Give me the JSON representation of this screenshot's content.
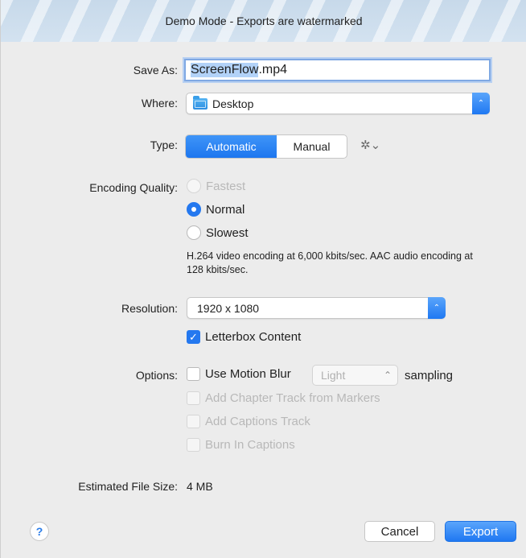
{
  "window": {
    "banner": "Demo Mode - Exports are watermarked"
  },
  "save_as": {
    "label": "Save As:",
    "selected_part": "ScreenFlow",
    "extension": ".mp4"
  },
  "where": {
    "label": "Where:",
    "value": "Desktop",
    "icon": "folder-icon"
  },
  "type": {
    "label": "Type:",
    "options": [
      "Automatic",
      "Manual"
    ],
    "selected": "Automatic"
  },
  "encoding_quality": {
    "label": "Encoding Quality:",
    "options": [
      {
        "label": "Fastest",
        "enabled": false,
        "selected": false
      },
      {
        "label": "Normal",
        "enabled": true,
        "selected": true
      },
      {
        "label": "Slowest",
        "enabled": true,
        "selected": false
      }
    ],
    "description": "H.264 video encoding at 6,000 kbits/sec.  AAC audio encoding at 128 kbits/sec."
  },
  "resolution": {
    "label": "Resolution:",
    "value": "1920 x 1080",
    "letterbox_label": "Letterbox Content",
    "letterbox_checked": true
  },
  "options": {
    "label": "Options:",
    "motion_blur": {
      "label": "Use Motion Blur",
      "checked": false,
      "sampling_value": "Light",
      "suffix": "sampling"
    },
    "chapter_track": {
      "label": "Add Chapter Track from Markers",
      "enabled": false
    },
    "captions_track": {
      "label": "Add Captions Track",
      "enabled": false
    },
    "burn_captions": {
      "label": "Burn In Captions",
      "enabled": false
    }
  },
  "estimated_size": {
    "label": "Estimated File Size:",
    "value": "4 MB"
  },
  "buttons": {
    "help": "?",
    "cancel": "Cancel",
    "export": "Export"
  },
  "colors": {
    "accent": "#2478ef",
    "banner": "#c7d9ea",
    "background": "#ececec"
  }
}
